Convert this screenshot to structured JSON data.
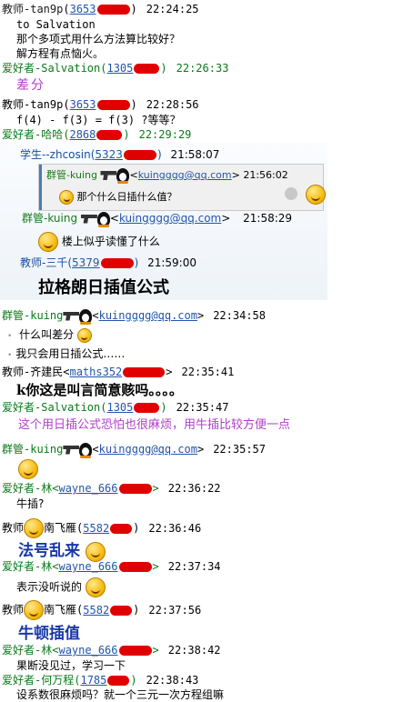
{
  "messages": [
    {
      "sender": "教师-tan9p",
      "qq": "3653",
      "time": "22:24:25"
    },
    {
      "text": "to Salvation"
    },
    {
      "text": "那个多项式用什么方法算比较好？"
    },
    {
      "text": "解方程有点恼火。"
    },
    {
      "sender": "爱好者-Salvation",
      "qq": "1305",
      "time": "22:26:33"
    },
    {
      "text": "差分"
    },
    {
      "sender": "教师-tan9p",
      "qq": "3653",
      "time": "22:28:56"
    },
    {
      "text": "f(4) - f(3) = f(3) ?等等？"
    },
    {
      "sender": "爱好者-哈哈",
      "qq": "2868",
      "time": "22:29:29"
    }
  ],
  "embedded": {
    "student": {
      "sender": "学生--zhcosin",
      "qq": "5323",
      "time": "21:58:07"
    },
    "quote": {
      "sender": "群管-kuing",
      "email": "kuingggg@qq.com",
      "time": "21:56:02",
      "text": "那个什么日插什么值？"
    },
    "kuing": {
      "sender": "群管-kuing",
      "email": "kuingggg@qq.com",
      "time": "21:58:29",
      "text": "楼上似乎读懂了什么"
    },
    "teacher": {
      "sender": "教师-三千",
      "qq": "5379",
      "time": "21:59:00",
      "text": "拉格朗日插值公式"
    }
  },
  "messages2": [
    {
      "sender": "群管-kuing",
      "email": "kuingggg@qq.com",
      "time": "22:34:58"
    },
    {
      "text": "什么叫差分"
    },
    {
      "text": "我只会用日插公式……"
    },
    {
      "sender": "教师-齐建民",
      "qq": "maths352",
      "time": "22:35:41"
    },
    {
      "text": "k你这是叫言简意赅吗。。。。"
    },
    {
      "sender": "爱好者-Salvation",
      "qq": "1305",
      "time": "22:35:47"
    },
    {
      "text": "这个用日插公式恐怕也很麻烦，用牛插比较方便一点"
    },
    {
      "sender": "群管-kuing",
      "email": "kuingggg@qq.com",
      "time": "22:35:57"
    },
    {
      "sender": "爱好者-林",
      "qq": "wayne_666",
      "time": "22:36:22"
    },
    {
      "text": "牛插?"
    },
    {
      "sender": "教师",
      "name2": "南飞雁",
      "qq": "5582",
      "time": "22:36:46"
    },
    {
      "text": "法号乱来"
    },
    {
      "sender": "爱好者-林",
      "qq": "wayne_666",
      "time": "22:37:34"
    },
    {
      "text": "表示没听说的"
    },
    {
      "sender": "教师",
      "name2": "南飞雁",
      "qq": "5582",
      "time": "22:37:56"
    },
    {
      "text": "牛顿插值"
    },
    {
      "sender": "爱好者-林",
      "qq": "wayne_666",
      "time": "22:38:42"
    },
    {
      "text": "果断没见过，学习一下"
    },
    {
      "sender": "爱好者-何万程",
      "qq": "1785",
      "time": "22:38:43"
    },
    {
      "text": "设系数很麻烦吗？就一个三元一次方程组嘛"
    }
  ]
}
